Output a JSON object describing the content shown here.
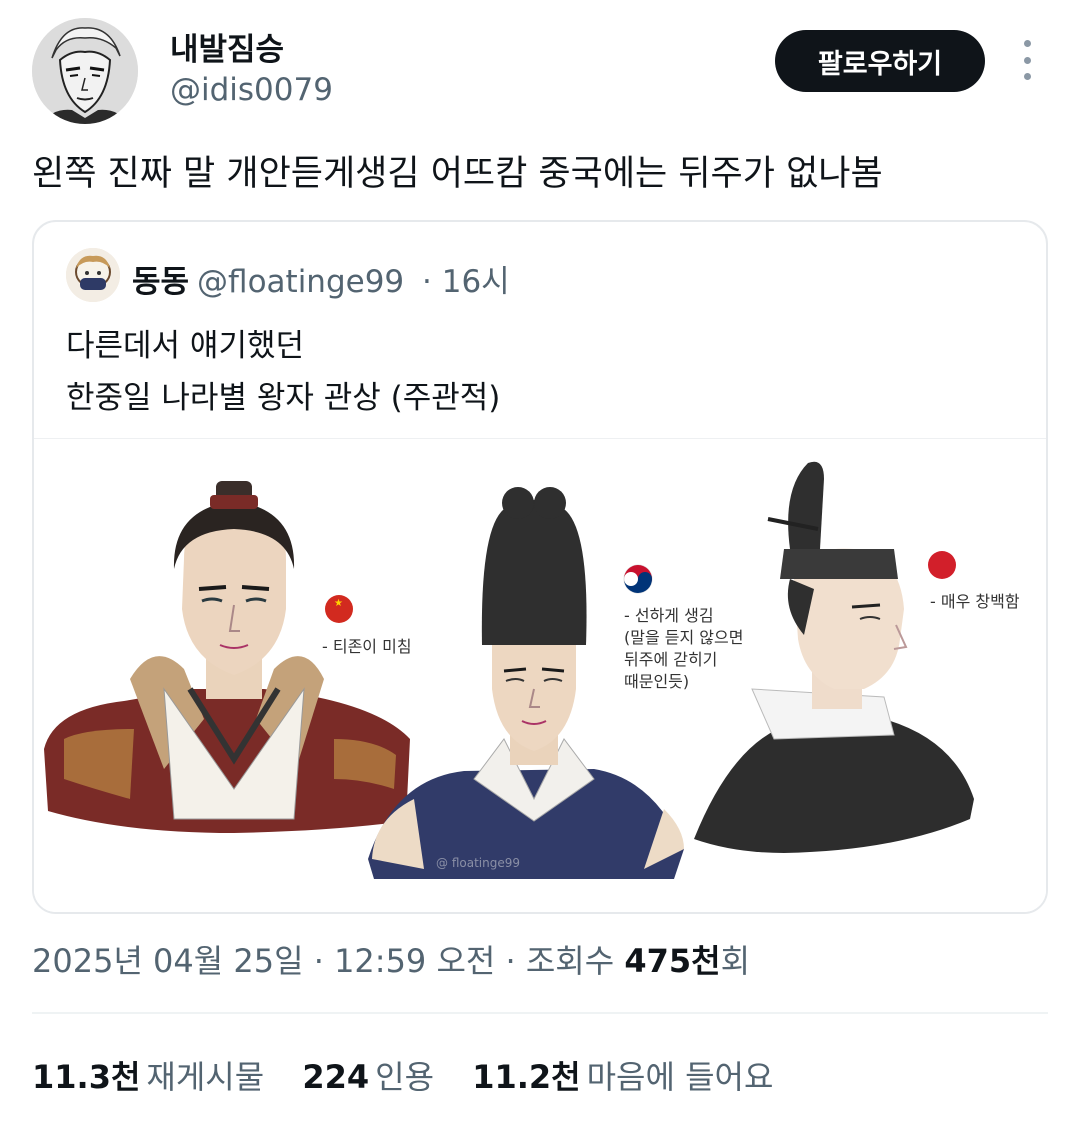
{
  "author": {
    "name": "내발짐승",
    "handle": "@idis0079",
    "follow_label": "팔로우하기"
  },
  "tweet": {
    "text": "왼쪽 진짜 말 개안듣게생김 어뜨캄 중국에는 뒤주가 없나봄"
  },
  "quote": {
    "name": "동동",
    "handle": "@floatinge99",
    "time": "· 16시",
    "lines": [
      "다른데서 얘기했던",
      "한중일 나라별 왕자 관상 (주관적)"
    ],
    "illustration": {
      "label_china": "- 티존이 미침",
      "label_korea": [
        "- 선하게 생김",
        "(말을 듣지 않으면",
        "뒤주에 갇히기",
        "때문인듯)"
      ],
      "label_japan": "- 매우 창백함",
      "signature": "@ floatinge99"
    }
  },
  "meta": {
    "date": "2025년 04월 25일",
    "sep1": " · ",
    "time": "12:59 오전",
    "sep2": " · ",
    "views_prefix": "조회수 ",
    "views_count": "475천",
    "views_suffix": "회"
  },
  "stats": {
    "retweets_count": "11.3천",
    "retweets_label": "재게시물",
    "quotes_count": "224",
    "quotes_label": "인용",
    "likes_count": "11.2천",
    "likes_label": "마음에 들어요"
  },
  "colors": {
    "text_primary": "#0f1419",
    "text_secondary": "#536471",
    "button_bg": "#0f1419",
    "border": "#e6e9ec"
  }
}
